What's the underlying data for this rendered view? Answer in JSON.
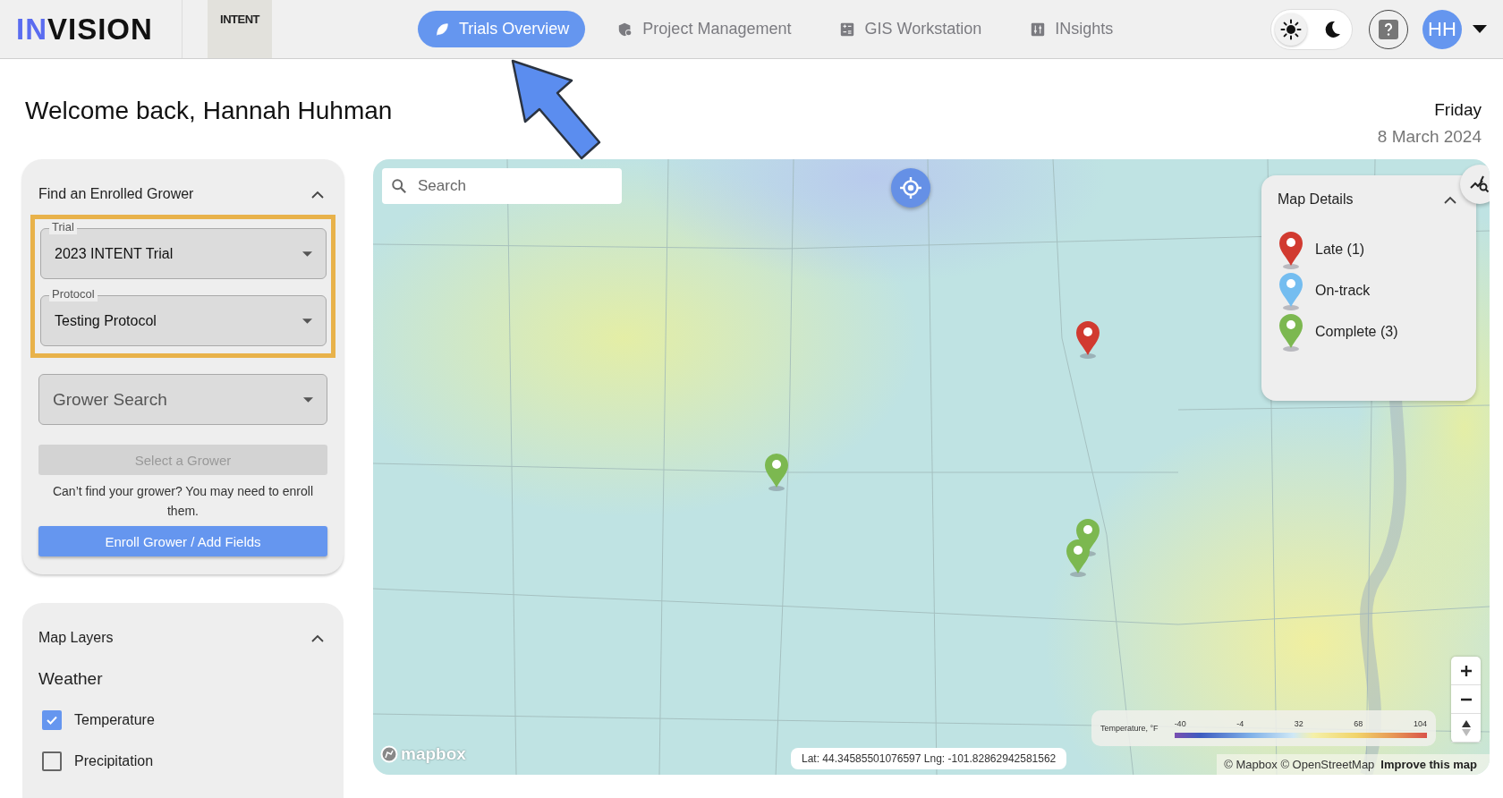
{
  "header": {
    "logo": {
      "accent": "IN",
      "rest": "VISION"
    },
    "partner_logo": "INTENT",
    "nav": [
      {
        "label": "Trials Overview",
        "selected": true
      },
      {
        "label": "Project Management",
        "selected": false
      },
      {
        "label": "GIS Workstation",
        "selected": false
      },
      {
        "label": "INsights",
        "selected": false
      }
    ],
    "theme_toggle": [
      {
        "kind": "light",
        "selected": true
      },
      {
        "kind": "dark",
        "selected": false
      }
    ],
    "avatar": "HH"
  },
  "greeting": "Welcome back, Hannah Huhman",
  "date": {
    "day": "Friday",
    "date": "8 March 2024"
  },
  "grower_panel": {
    "title": "Find an Enrolled Grower",
    "expanded": true,
    "fields": [
      {
        "label": "Trial",
        "value": "2023 INTENT Trial"
      },
      {
        "label": "Protocol",
        "value": "Testing Protocol"
      }
    ],
    "grower_search": {
      "placeholder": "Grower Search"
    },
    "select_button": {
      "label": "Select a Grower",
      "disabled": true
    },
    "hint": "Can’t find your grower? You may need to enroll them.",
    "enroll_button": "Enroll Grower / Add Fields"
  },
  "layers_panel": {
    "title": "Map Layers",
    "expanded": true,
    "section": "Weather",
    "layers": [
      {
        "label": "Temperature",
        "checked": true
      },
      {
        "label": "Precipitation",
        "checked": false
      }
    ]
  },
  "map": {
    "search": {
      "placeholder": "Search"
    },
    "details": {
      "title": "Map Details",
      "expanded": true,
      "legend": [
        {
          "label": "Late (1)",
          "color": "#d13a30"
        },
        {
          "label": "On-track",
          "color": "#74bdf0"
        },
        {
          "label": "Complete (3)",
          "color": "#7cb850"
        }
      ]
    },
    "markers": [
      {
        "color": "#d13a30"
      },
      {
        "color": "#7cb850"
      },
      {
        "color": "#7cb850"
      },
      {
        "color": "#7cb850"
      }
    ],
    "coordinates": "Lat: 44.34585501076597 Lng: -101.82862942581562",
    "temperature_legend": {
      "title": "Temperature, °F",
      "ticks": [
        "-40",
        "-4",
        "32",
        "68",
        "104"
      ]
    },
    "mapbox_logo": "mapbox",
    "attribution": "© Mapbox © OpenStreetMap",
    "improve_link": "Improve this map"
  }
}
